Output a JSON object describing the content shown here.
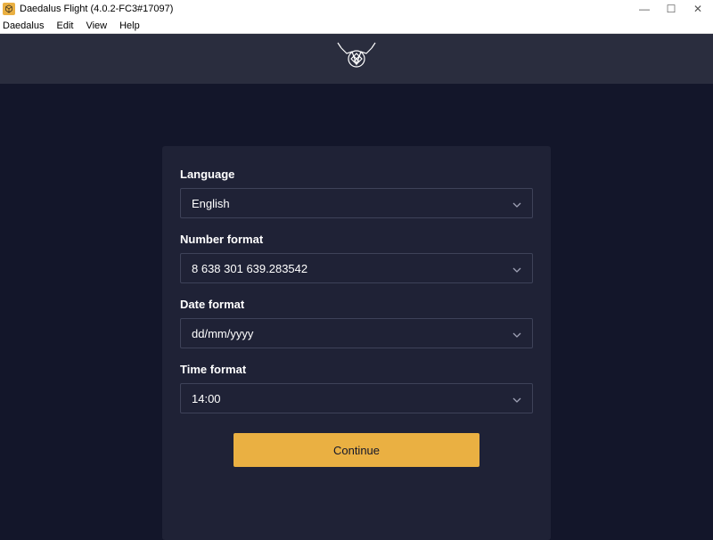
{
  "window": {
    "title": "Daedalus Flight (4.0.2-FC3#17097)"
  },
  "menubar": {
    "items": [
      "Daedalus",
      "Edit",
      "View",
      "Help"
    ]
  },
  "form": {
    "language": {
      "label": "Language",
      "value": "English"
    },
    "number_format": {
      "label": "Number format",
      "value": "8 638 301 639.283542"
    },
    "date_format": {
      "label": "Date format",
      "value": "dd/mm/yyyy"
    },
    "time_format": {
      "label": "Time format",
      "value": "14:00"
    },
    "continue_label": "Continue"
  },
  "colors": {
    "accent": "#eab042",
    "panel": "#1f2236",
    "bg": "#13162a",
    "banner": "#2a2d3e"
  }
}
